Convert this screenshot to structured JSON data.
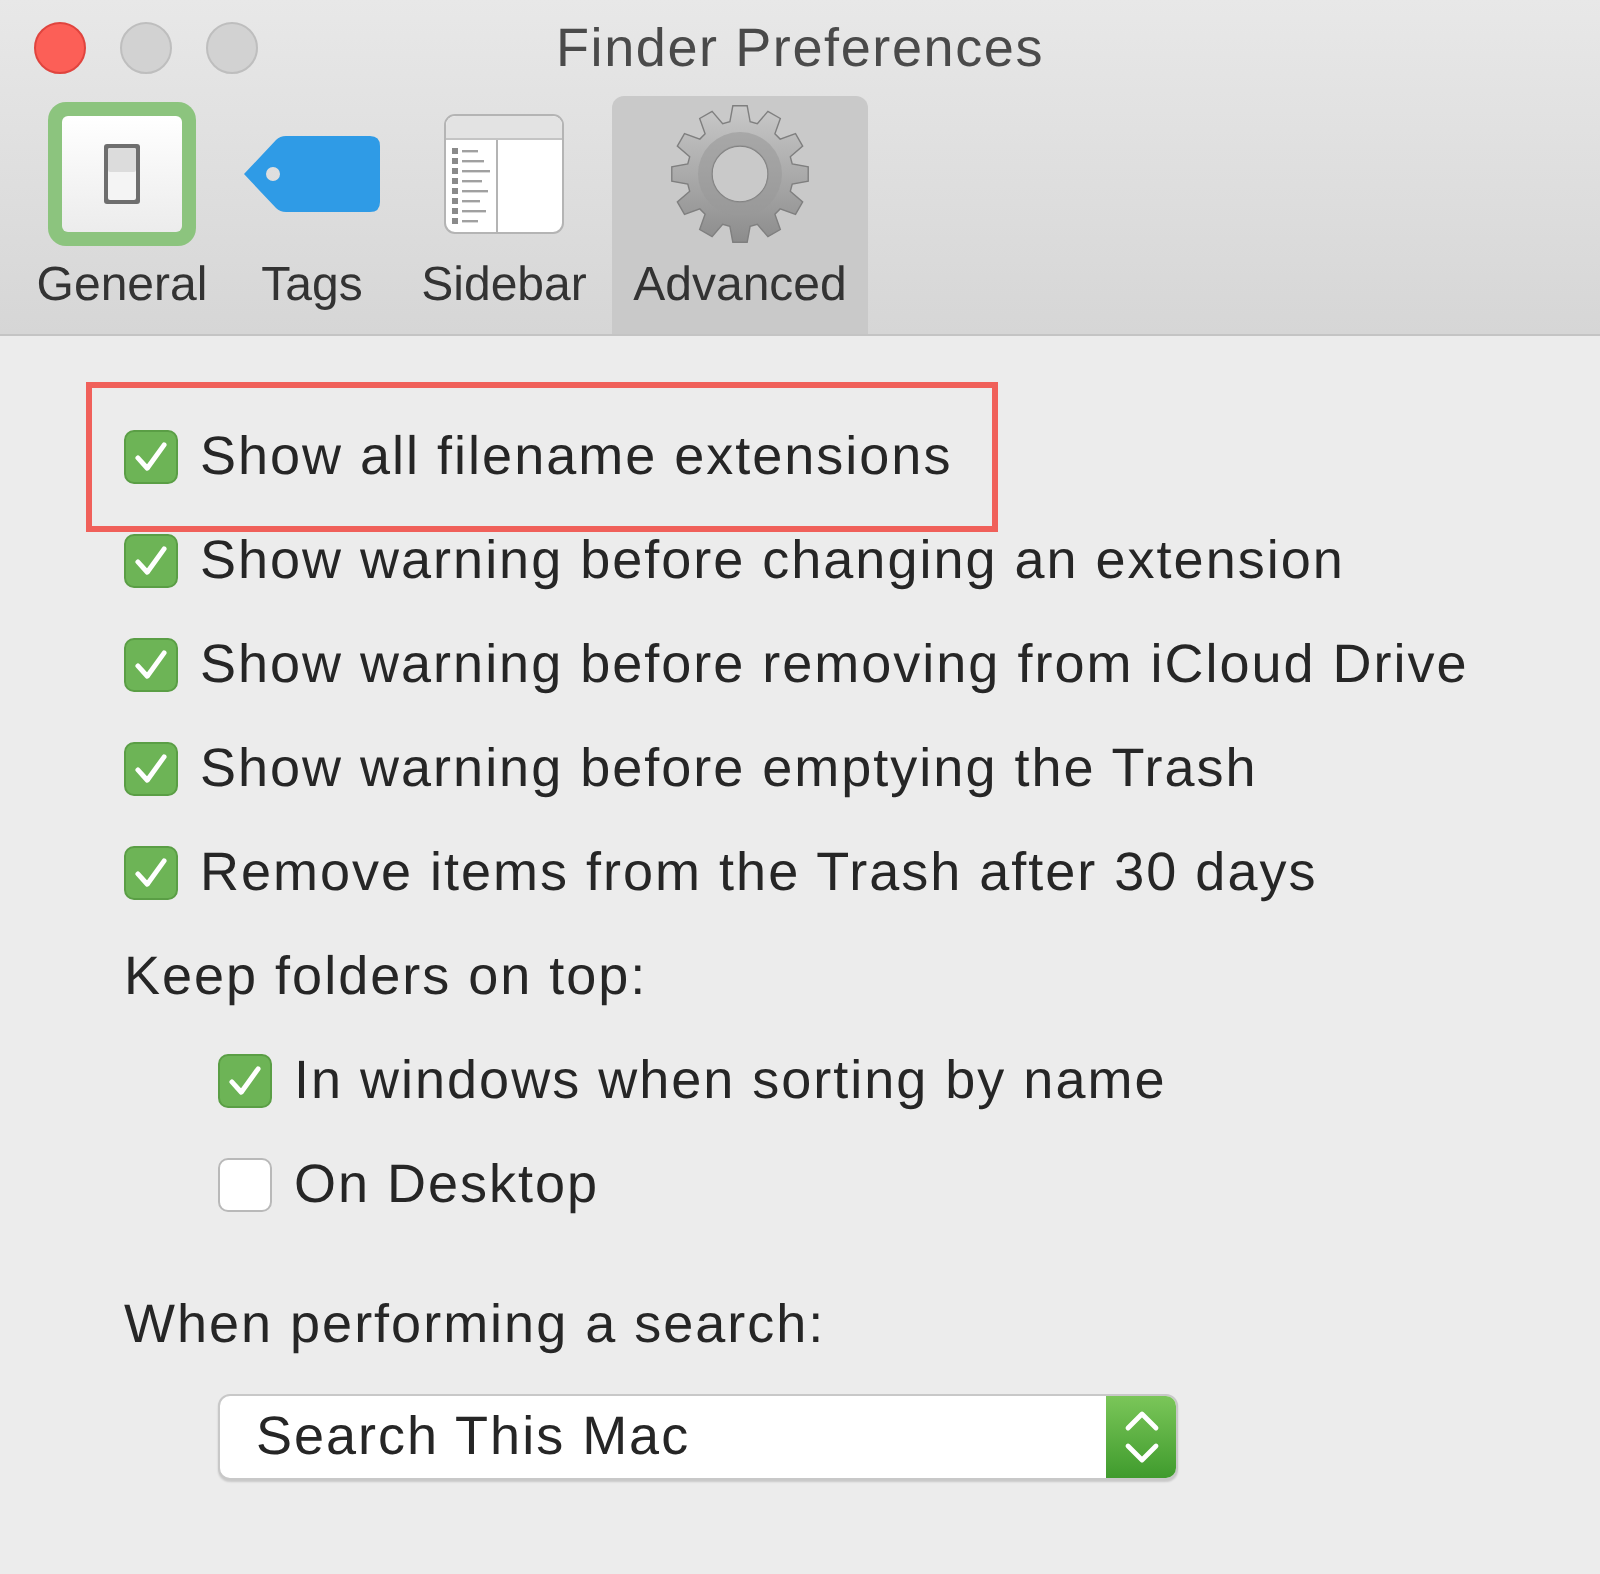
{
  "window": {
    "title": "Finder Preferences",
    "buttons": [
      {
        "kind": "close",
        "disabled": false
      },
      {
        "kind": "minimize",
        "disabled": true
      },
      {
        "kind": "zoom",
        "disabled": true
      }
    ]
  },
  "tabs": [
    {
      "kind": "general",
      "label": "General",
      "selected": false
    },
    {
      "kind": "tags",
      "label": "Tags",
      "selected": false
    },
    {
      "kind": "sidebar",
      "label": "Sidebar",
      "selected": false
    },
    {
      "kind": "advanced",
      "label": "Advanced",
      "selected": true
    }
  ],
  "options": [
    {
      "label": "Show all filename extensions",
      "checked": true,
      "highlighted": true
    },
    {
      "label": "Show warning before changing an extension",
      "checked": true,
      "highlighted": false
    },
    {
      "label": "Show warning before removing from iCloud Drive",
      "checked": true,
      "highlighted": false
    },
    {
      "label": "Show warning before emptying the Trash",
      "checked": true,
      "highlighted": false
    },
    {
      "label": "Remove items from the Trash after 30 days",
      "checked": true,
      "highlighted": false
    }
  ],
  "folders": {
    "heading": "Keep folders on top:",
    "options": [
      {
        "label": "In windows when sorting by name",
        "checked": true
      },
      {
        "label": "On Desktop",
        "checked": false
      }
    ]
  },
  "search": {
    "heading": "When performing a search:",
    "value": "Search This Mac"
  }
}
